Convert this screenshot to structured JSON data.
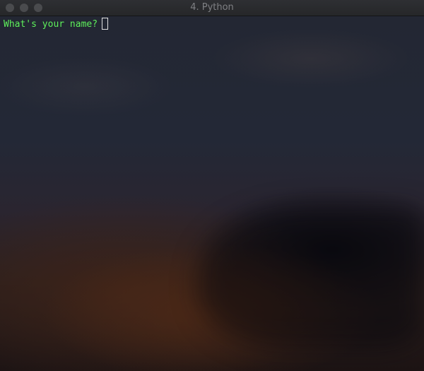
{
  "window": {
    "title": "4. Python"
  },
  "terminal": {
    "prompt": "What's your name?"
  },
  "colors": {
    "prompt_text": "#5ef05b",
    "title_text": "#7f8084",
    "traffic_light": "#4a4b4e"
  },
  "icons": {
    "close": "close-dot-icon",
    "minimize": "minimize-dot-icon",
    "zoom": "zoom-dot-icon"
  }
}
